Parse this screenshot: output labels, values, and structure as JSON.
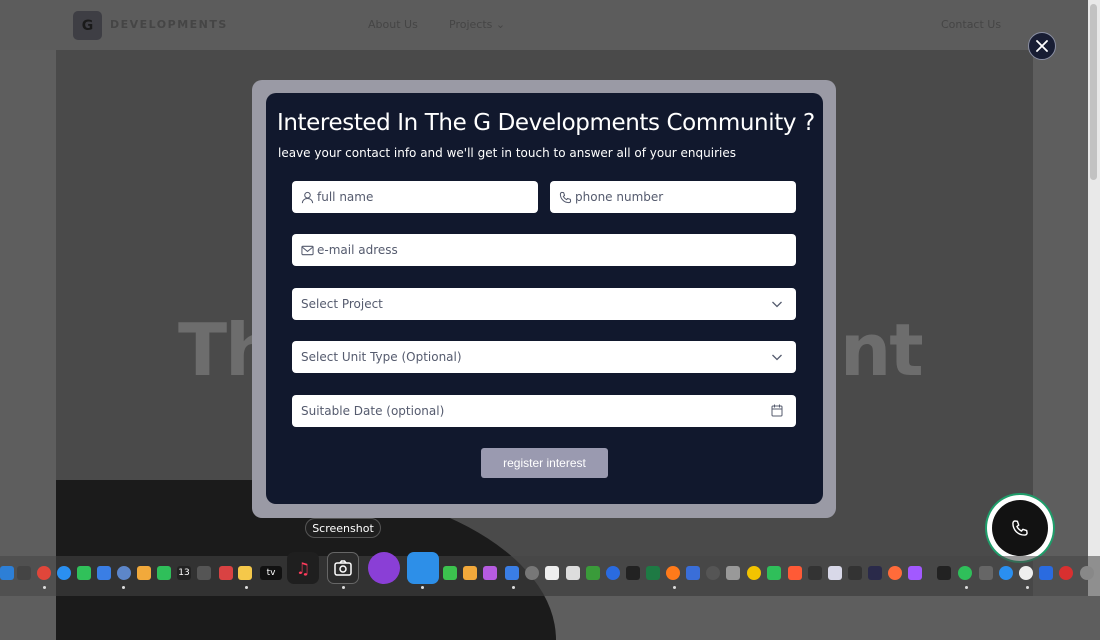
{
  "site": {
    "logo_letter": "G",
    "logo_text": "DEVELOPMENTS",
    "nav": {
      "about": "About Us",
      "projects": "Projects",
      "contact": "Contact Us"
    },
    "hero_left": "Th",
    "hero_right": "nt"
  },
  "modal": {
    "title": "Interested In The G Developments Community ?",
    "subtitle": "leave your contact info and we'll get in touch to answer all of your enquiries",
    "full_name_placeholder": "full name",
    "phone_placeholder": "phone number",
    "email_placeholder": "e-mail adress",
    "project_select": "Select Project",
    "unit_select": "Select Unit Type (Optional)",
    "date_placeholder": "Suitable Date (optional)",
    "submit_label": "register interest"
  },
  "close_icon": "close-icon",
  "fab_icon": "phone-icon",
  "tooltip": "Screenshot",
  "dock": {
    "calendar_day": "13",
    "tv_label": "tv"
  },
  "colors": {
    "modal_bg": "#11182d",
    "modal_frame": "#9a9aa5",
    "submit_bg": "#9a9ab0",
    "fab_ring": "#1f9d6a"
  }
}
